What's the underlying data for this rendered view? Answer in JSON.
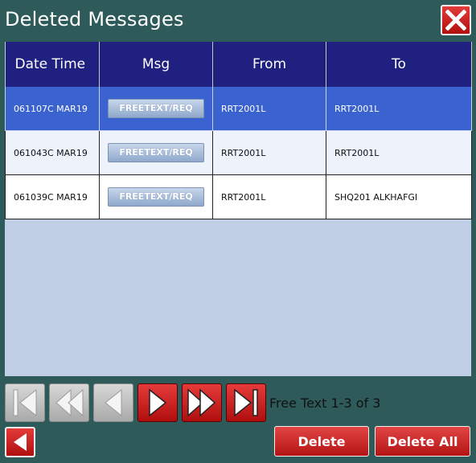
{
  "window": {
    "title": "Deleted Messages"
  },
  "table": {
    "headers": [
      "Date Time",
      "Msg",
      "From",
      "To"
    ],
    "rows": [
      {
        "datetime": "061107C MAR19",
        "msg": "FREETEXT/REQ",
        "from": "RRT2001L",
        "to": "RRT2001L"
      },
      {
        "datetime": "061043C MAR19",
        "msg": "FREETEXT/REQ",
        "from": "RRT2001L",
        "to": "RRT2001L"
      },
      {
        "datetime": "061039C MAR19",
        "msg": "FREETEXT/REQ",
        "from": "RRT2001L",
        "to": "SHQ201 ALKHAFGI"
      }
    ]
  },
  "pagination": {
    "text": "Free Text 1-3 of 3"
  },
  "actions": {
    "delete": "Delete",
    "delete_all": "Delete All"
  },
  "icons": {
    "close": "close-x-icon",
    "first": "first-page-icon",
    "fast_back": "fast-back-icon",
    "prev": "previous-page-icon",
    "next": "next-page-icon",
    "fast_forward": "fast-forward-icon",
    "last": "last-page-icon",
    "back": "back-arrow-icon"
  },
  "colors": {
    "background": "#2e5a5a",
    "header": "#1f2080",
    "selected_row": "#3b63d0",
    "panel": "#c0cfe6",
    "accent_red": "#c81e1e"
  }
}
